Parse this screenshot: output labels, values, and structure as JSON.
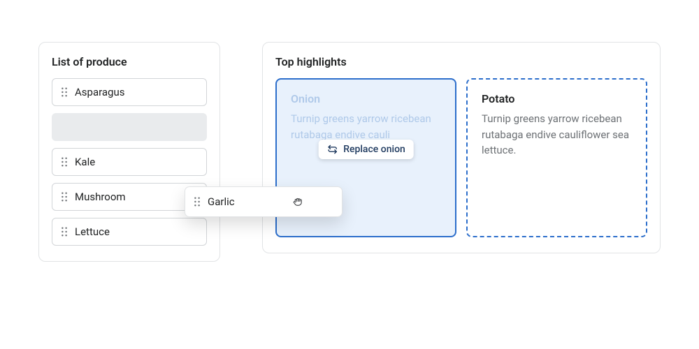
{
  "list": {
    "title": "List of produce",
    "items": [
      "Asparagus",
      "Kale",
      "Mushroom",
      "Lettuce"
    ],
    "dragging": "Garlic"
  },
  "highlights": {
    "title": "Top highlights",
    "cards": [
      {
        "title": "Onion",
        "body": "Turnip greens yarrow ricebean rutabaga endive cauli",
        "replaceLabel": "Replace onion"
      },
      {
        "title": "Potato",
        "body": "Turnip greens yarrow ricebean rutabaga endive cauliflower sea lettuce."
      }
    ]
  }
}
